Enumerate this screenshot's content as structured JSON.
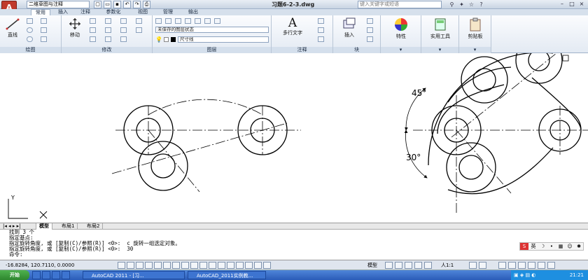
{
  "titlebar": {
    "app_button": "A",
    "workspace": "二维草图与注释",
    "doc_title": "习题6-2-3.dwg",
    "search_placeholder": "键入关键字或短语",
    "qat_icons": [
      "new-icon",
      "open-icon",
      "save-icon",
      "undo-icon",
      "redo-icon",
      "plot-icon"
    ],
    "window_buttons": [
      "–",
      "□",
      "×"
    ]
  },
  "ribbon_tabs": [
    "常用",
    "插入",
    "注释",
    "参数化",
    "视图",
    "管理",
    "输出"
  ],
  "ribbon": {
    "draw": {
      "line_label": "直线",
      "panel": "绘图"
    },
    "modify": {
      "move_label": "移动",
      "panel": "修改"
    },
    "layers": {
      "layer_state": "未保存的图层状态",
      "current_layer": "尺寸线",
      "panel": "图层"
    },
    "annotation": {
      "mtext_label": "多行文字",
      "panel": "注释"
    },
    "block": {
      "insert_label": "插入",
      "panel": "块"
    },
    "properties_label": "特性",
    "utilities_label": "实用工具",
    "clipboard_label": "剪贴板"
  },
  "drawing": {
    "angle_45": "45°",
    "angle_30": "30°",
    "ucs_x": "X",
    "ucs_y": "Y"
  },
  "layout_tabs": [
    "模型",
    "布局1",
    "布局2"
  ],
  "command_lines": [
    "找到 3 个",
    "指定基点:",
    "指定旋转角度, 或 [复制(C)/参照(R)] <0>:  c 旋转一组选定对象。",
    "指定旋转角度, 或 [复制(C)/参照(R)] <0>:  30",
    "命令:"
  ],
  "ime": [
    "S",
    "英"
  ],
  "status": {
    "coords": "-16.8284, 120.7110, 0.0000",
    "model": "模型",
    "scale": "人1:1"
  },
  "taskbar": {
    "start": "开始",
    "tasks": [
      "AutoCAD 2011 - [习...",
      "AutoCAD_2011实例教..."
    ],
    "clock": "21:21"
  }
}
